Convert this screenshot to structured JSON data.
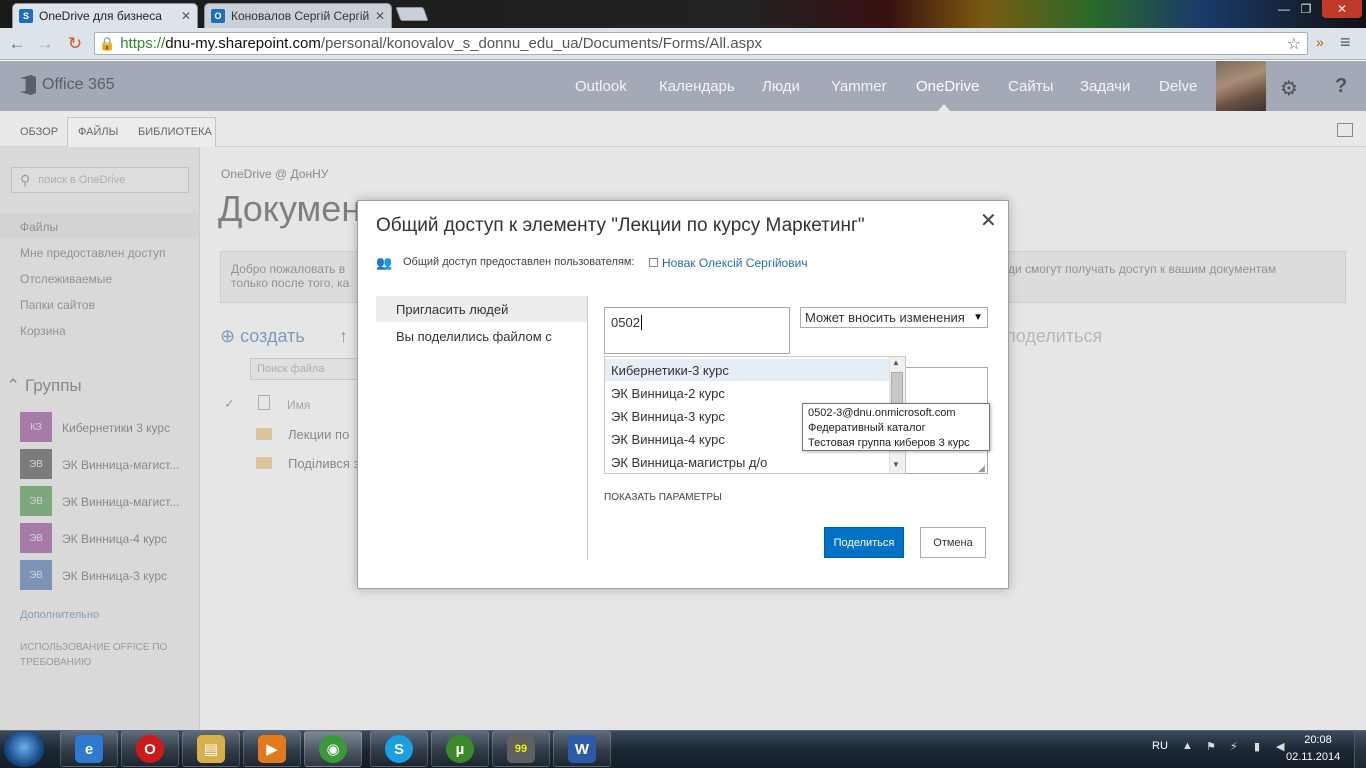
{
  "browser": {
    "tabs": [
      {
        "title": "OneDrive для бизнеса",
        "favicon": "S",
        "favicon_color": "#1e6fb8"
      },
      {
        "title": "Коновалов Сергій Сергій",
        "favicon": "O",
        "favicon_color": "#1e6fb8"
      }
    ],
    "close_glyph": "✕",
    "url_scheme": "https://",
    "url_host": "dnu-my.sharepoint.com",
    "url_path": "/personal/konovalov_s_donnu_edu_ua/Documents/Forms/All.aspx",
    "window_controls": [
      "—",
      "❐",
      "✕"
    ]
  },
  "o365": {
    "brand": "Office 365",
    "nav": [
      "Outlook",
      "Календарь",
      "Люди",
      "Yammer",
      "OneDrive",
      "Сайты",
      "Задачи",
      "Delve"
    ],
    "active_nav": "OneDrive",
    "gear": "⚙",
    "help": "?"
  },
  "ribbon": {
    "tabs": [
      "ОБЗОР",
      "ФАЙЛЫ",
      "БИБЛИОТЕКА"
    ]
  },
  "leftnav": {
    "search_placeholder": "поиск в OneDrive",
    "items": [
      "Файлы",
      "Мне предоставлен доступ",
      "Отслеживаемые",
      "Папки сайтов",
      "Корзина"
    ],
    "groups_title": "Группы",
    "groups": [
      {
        "initials": "КЗ",
        "label": "Кибернетики 3 курс",
        "color": "#8b3d8f"
      },
      {
        "initials": "ЭВ",
        "label": "ЭК Винница-магист...",
        "color": "#3c3c3c"
      },
      {
        "initials": "ЭВ",
        "label": "ЭК Винница-магист...",
        "color": "#3f8a3f"
      },
      {
        "initials": "ЭВ",
        "label": "ЭК Винница-4 курс",
        "color": "#8b3d8f"
      },
      {
        "initials": "ЭВ",
        "label": "ЭК Винница-3 курс",
        "color": "#3e66a8"
      }
    ],
    "more": "Дополнительно",
    "office_use": "ИСПОЛЬЗОВАНИЕ OFFICE ПО ТРЕБОВАНИЮ"
  },
  "main": {
    "breadcrumb": "OneDrive @ ДонНУ",
    "title": "Докумен",
    "welcome_left": "Добро пожаловать в",
    "welcome_left2": "только после того, ка",
    "welcome_right": "ди смогут получать доступ к вашим документам",
    "create": "создать",
    "share": "поделиться",
    "file_search_placeholder": "Поиск файла",
    "col_name": "Имя",
    "files": [
      "Лекции по",
      "Поділився з"
    ]
  },
  "dialog": {
    "title": "Общий доступ к элементу \"Лекции по курсу Маркетинг\"",
    "shared_with_label": "Общий доступ предоставлен пользователям:",
    "shared_user": "Новак Олексій Сергійович",
    "tabs": [
      "Пригласить людей",
      "Вы поделились файлом с"
    ],
    "invite_value": "0502",
    "permission": "Может вносить изменения",
    "autocomplete": [
      "Кибернетики-3 курс",
      "ЭК Винница-2 курс",
      "ЭК Винница-3 курс",
      "ЭК Винница-4 курс",
      "ЭК Винница-магистры д/о"
    ],
    "tooltip": [
      "0502-3@dnu.onmicrosoft.com",
      "Федеративный каталог",
      "Тестовая группа киберов 3 курс"
    ],
    "show_params": "ПОКАЗАТЬ ПАРАМЕТРЫ",
    "share_btn": "Поделиться",
    "cancel_btn": "Отмена"
  },
  "taskbar": {
    "apps": [
      {
        "name": "internet-explorer",
        "glyph": "e",
        "color": "#2d7bd0"
      },
      {
        "name": "opera",
        "glyph": "O",
        "color": "#d01a1a"
      },
      {
        "name": "explorer",
        "glyph": "▤",
        "color": "#d8b04a"
      },
      {
        "name": "media-player",
        "glyph": "▶",
        "color": "#e07a1a"
      },
      {
        "name": "chrome",
        "glyph": "◉",
        "color": "#3a9a3a"
      },
      {
        "name": "skype",
        "glyph": "S",
        "color": "#1aa0e0"
      },
      {
        "name": "utorrent",
        "glyph": "µ",
        "color": "#3a8a2a"
      },
      {
        "name": "app-99",
        "glyph": "99",
        "color": "#606060"
      },
      {
        "name": "word",
        "glyph": "W",
        "color": "#2a5aa8"
      }
    ],
    "lang": "RU",
    "time": "20:08",
    "date": "02.11.2014"
  }
}
